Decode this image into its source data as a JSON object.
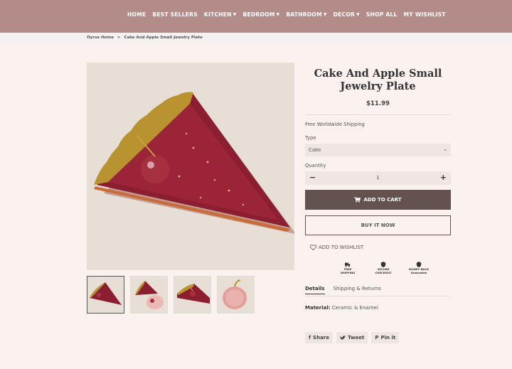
{
  "nav": {
    "items": [
      {
        "label": "HOME",
        "dropdown": false
      },
      {
        "label": "BEST SELLERS",
        "dropdown": false
      },
      {
        "label": "KITCHEN",
        "dropdown": true
      },
      {
        "label": "BEDROOM",
        "dropdown": true
      },
      {
        "label": "BATHROOM",
        "dropdown": true
      },
      {
        "label": "DECOR",
        "dropdown": true
      },
      {
        "label": "SHOP ALL",
        "dropdown": false
      },
      {
        "label": "MY WISHLIST",
        "dropdown": false
      }
    ],
    "background": "#b38b89"
  },
  "breadcrumb": {
    "home": "Oyrus Home",
    "separator": ">",
    "current": "Cake And Apple Small Jewelry Plate"
  },
  "product": {
    "title": "Cake And Apple Small Jewelry Plate",
    "price": "$11.99",
    "shipping": "Free Worldwide Shipping",
    "type_label": "Type",
    "type_value": "Cake",
    "quantity_label": "Quantity",
    "quantity_value": "1",
    "minus": "−",
    "plus": "+",
    "add_to_cart": "ADD TO CART",
    "buy_now": "BUY IT NOW",
    "add_to_wishlist": "ADD TO WISHLIST"
  },
  "badges": [
    {
      "label": "FREE SHIPPING",
      "icon": "truck-icon"
    },
    {
      "label": "SECURE CHECKOUT",
      "icon": "lock-shield-icon"
    },
    {
      "label": "MONEY BACK Guarantee",
      "icon": "money-shield-icon"
    }
  ],
  "tabs": [
    {
      "label": "Details",
      "active": true
    },
    {
      "label": "Shipping & Returns",
      "active": false
    }
  ],
  "details": {
    "material_label": "Material:",
    "material_value": "Ceramic & Enamel"
  },
  "share": {
    "facebook": "Share",
    "twitter": "Tweet",
    "pinterest": "Pin it"
  },
  "colors": {
    "accent_dark": "#64524f",
    "page_bg": "#fbf1ef"
  }
}
